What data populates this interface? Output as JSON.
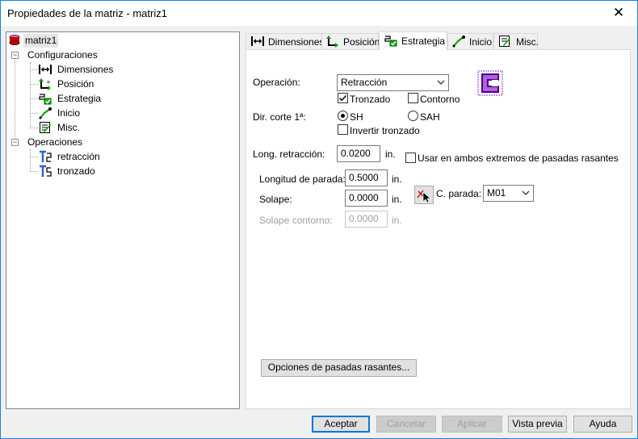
{
  "window": {
    "title": "Propiedades de la matriz - matriz1",
    "close_glyph": "✕"
  },
  "tree": {
    "root": "matriz1",
    "configuraciones": "Configuraciones",
    "config_items": [
      "Dimensiones",
      "Posición",
      "Estrategia",
      "Inicio",
      "Misc."
    ],
    "operaciones": "Operaciones",
    "op_items": [
      "retracción",
      "tronzado"
    ],
    "expander_glyph": "−"
  },
  "tabs": [
    "Dimensiones",
    "Posición",
    "Estrategia",
    "Inicio",
    "Misc."
  ],
  "active_tab": "Estrategia",
  "form": {
    "operacion_label": "Operación:",
    "operacion_value": "Retracción",
    "tronzado_label": "Tronzado",
    "tronzado_checked": true,
    "contorno_label": "Contorno",
    "contorno_checked": false,
    "dir_corte_label": "Dir. corte 1ª:",
    "sh_label": "SH",
    "sah_label": "SAH",
    "dir_selected": "SH",
    "invertir_label": "Invertir tronzado",
    "invertir_checked": false,
    "long_retraccion_label": "Long. retracción:",
    "long_retraccion_value": "0.0200",
    "unit": "in.",
    "usar_ambos_label": "Usar en ambos extremos de pasadas rasantes",
    "usar_ambos_checked": false,
    "longitud_parada_label": "Longitud de parada:",
    "longitud_parada_value": "0.5000",
    "solape_label": "Solape:",
    "solape_value": "0.0000",
    "solape_contorno_label": "Solape contorno:",
    "solape_contorno_value": "0.0000",
    "c_parada_label": "C. parada:",
    "c_parada_value": "M01",
    "opciones_button": "Opciones de pasadas rasantes..."
  },
  "buttons": {
    "aceptar": "Aceptar",
    "cancelar": "Cancelar",
    "aplicar": "Aplicar",
    "vista_previa": "Vista previa",
    "ayuda": "Ayuda"
  },
  "colors": {
    "accent": "#0078d7",
    "icon_purple": "#8a2be2",
    "icon_green": "#00a000"
  }
}
